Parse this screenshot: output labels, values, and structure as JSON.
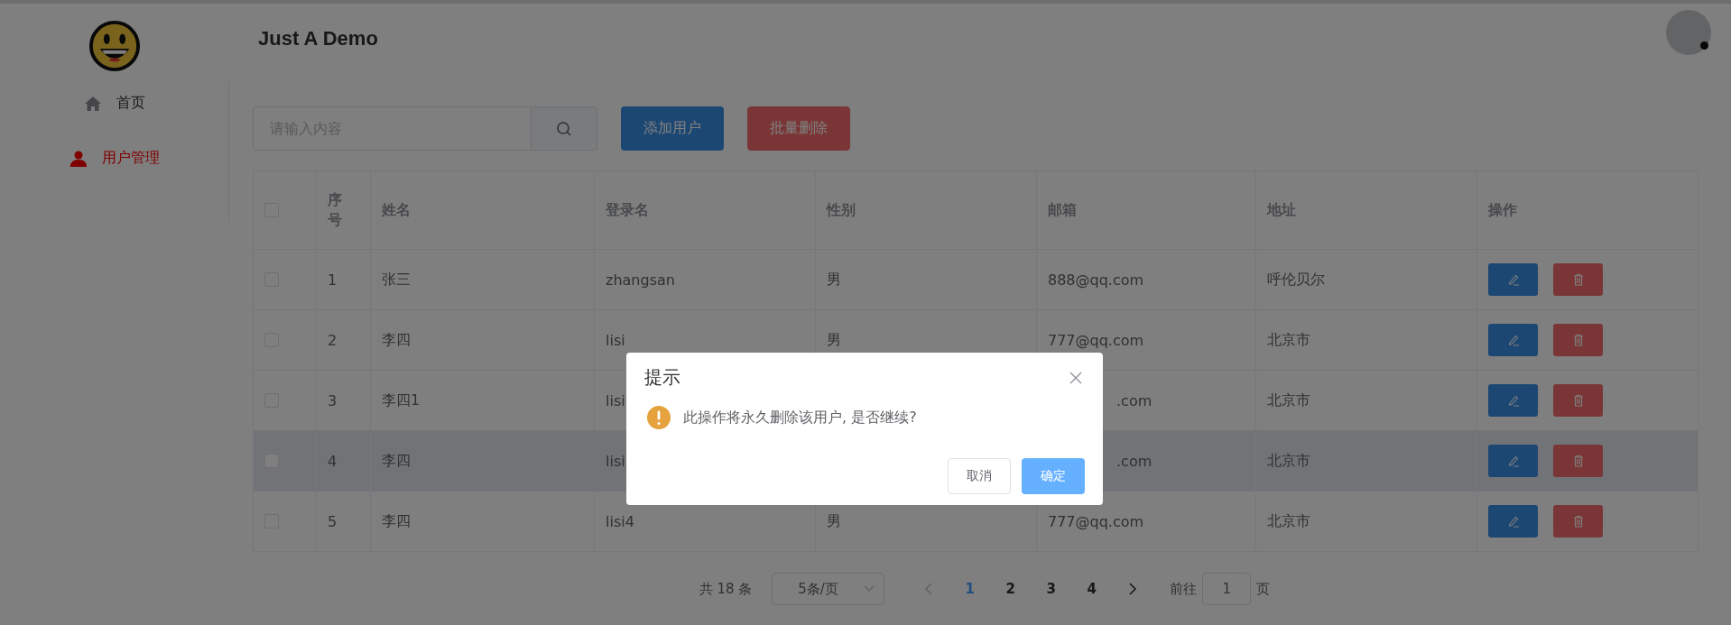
{
  "app": {
    "title": "Just A Demo"
  },
  "sidebar": {
    "items": [
      {
        "label": "首页",
        "kind": "home",
        "selected": false
      },
      {
        "label": "用户管理",
        "kind": "user",
        "selected": true
      }
    ]
  },
  "toolbar": {
    "search": {
      "placeholder": "请输入内容"
    },
    "buttons": [
      {
        "label": "添加用户",
        "kind": "primary"
      },
      {
        "label": "批量删除",
        "kind": "danger"
      }
    ]
  },
  "table": {
    "header_checked": false,
    "columns": [
      "序号",
      "姓名",
      "登录名",
      "性别",
      "邮箱",
      "地址",
      "操作"
    ],
    "rows": [
      {
        "checked": false,
        "hovered": false,
        "covered": false,
        "index": "1",
        "name": "张三",
        "login": "zhangsan",
        "gender": "男",
        "email": "888@qq.com",
        "address": "呼伦贝尔"
      },
      {
        "checked": false,
        "hovered": false,
        "covered": false,
        "index": "2",
        "name": "李四",
        "login": "lisi",
        "gender": "男",
        "email": "777@qq.com",
        "address": "北京市"
      },
      {
        "checked": false,
        "hovered": false,
        "covered": true,
        "index": "3",
        "name": "李四1",
        "login": "lisi",
        "email": ".com",
        "address": "北京市"
      },
      {
        "checked": false,
        "hovered": true,
        "covered": true,
        "index": "4",
        "name": "李四",
        "login": "lisi",
        "email": ".com",
        "address": "北京市"
      },
      {
        "checked": false,
        "hovered": false,
        "covered": false,
        "index": "5",
        "name": "李四",
        "login": "lisi4",
        "gender": "男",
        "email": "777@qq.com",
        "address": "北京市"
      }
    ]
  },
  "pagination": {
    "total": "共 18 条",
    "page_size": "5条/页",
    "pages": [
      {
        "label": "1",
        "selected": true
      },
      {
        "label": "2",
        "selected": false
      },
      {
        "label": "3",
        "selected": false
      },
      {
        "label": "4",
        "selected": false
      }
    ],
    "goto_label": "前往",
    "goto_value": "1",
    "goto_suffix": "页"
  },
  "dialog": {
    "title": "提示",
    "message": "此操作将永久删除该用户, 是否继续?",
    "buttons": [
      {
        "label": "取消",
        "kind": "default"
      },
      {
        "label": "确定",
        "kind": "primary"
      }
    ]
  }
}
